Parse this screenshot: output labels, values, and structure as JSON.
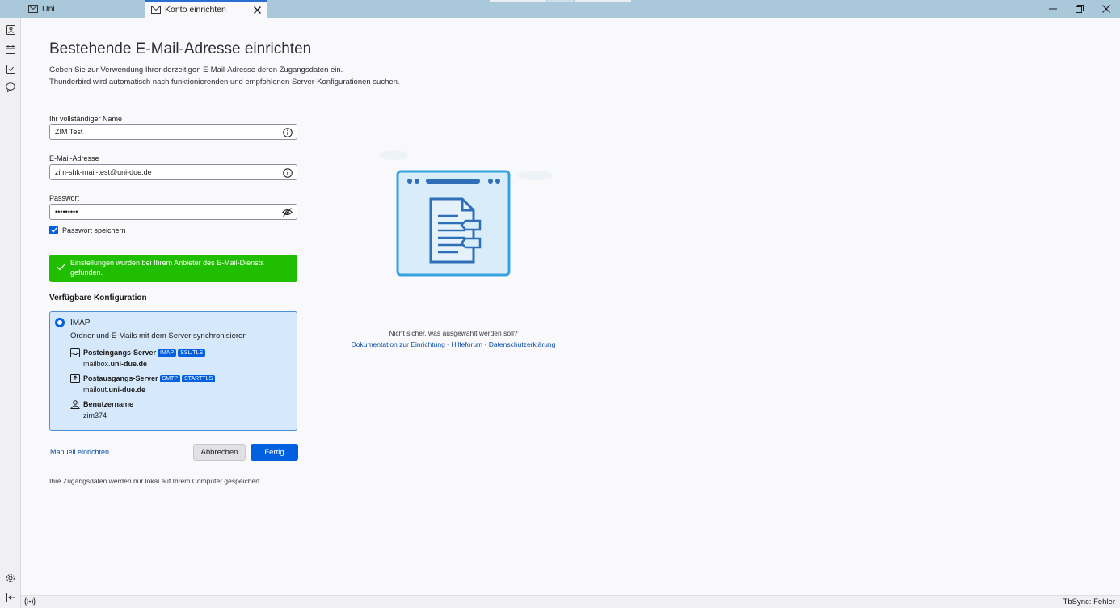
{
  "tabs": [
    {
      "label": "Uni",
      "icon": "mail-icon"
    },
    {
      "label": "Konto einrichten",
      "icon": "mail-setup-icon",
      "active": true
    }
  ],
  "page": {
    "title": "Bestehende E-Mail-Adresse einrichten",
    "intro_line1": "Geben Sie zur Verwendung Ihrer derzeitigen E-Mail-Adresse deren Zugangsdaten ein.",
    "intro_line2": "Thunderbird wird automatisch nach funktionierenden und empfohlenen Server-Konfigurationen suchen."
  },
  "form": {
    "name_label": "Ihr vollständiger Name",
    "name_value": "ZIM Test",
    "email_label": "E-Mail-Adresse",
    "email_value": "zim-shk-mail-test@uni-due.de",
    "password_label": "Passwort",
    "password_value": "•••••••••",
    "remember_label": "Passwort speichern",
    "remember_checked": true
  },
  "success_message": "Einstellungen wurden bei Ihrem Anbieter des E-Mail-Diensts gefunden.",
  "config": {
    "heading": "Verfügbare Konfiguration",
    "protocol": "IMAP",
    "description": "Ordner und E-Mails mit dem Server synchronisieren",
    "incoming_label": "Posteingangs-Server",
    "incoming_tags": [
      "IMAP",
      "SSL/TLS"
    ],
    "incoming_host_prefix": "mailbox.",
    "incoming_host_domain": "uni-due.de",
    "outgoing_label": "Postausgangs-Server",
    "outgoing_tags": [
      "SMTP",
      "STARTTLS"
    ],
    "outgoing_host_prefix": "mailout.",
    "outgoing_host_domain": "uni-due.de",
    "username_label": "Benutzername",
    "username_value": "zim374"
  },
  "actions": {
    "manual": "Manuell einrichten",
    "cancel": "Abbrechen",
    "done": "Fertig"
  },
  "footnote": "Ihre Zugangsdaten werden nur lokal auf Ihrem Computer gespeichert.",
  "help": {
    "unsure": "Nicht sicher, was ausgewählt werden soll?",
    "link_docs": "Dokumentation zur Einrichtung",
    "link_forum": "Hilfeforum",
    "link_privacy": "Datenschutzerklärung",
    "separator": " - "
  },
  "status": {
    "text": "TbSync: Fehler"
  },
  "colors": {
    "accent": "#0060df",
    "success": "#1fbf00",
    "titlebar": "#a9c9da",
    "config_bg": "#d6e8fb"
  }
}
